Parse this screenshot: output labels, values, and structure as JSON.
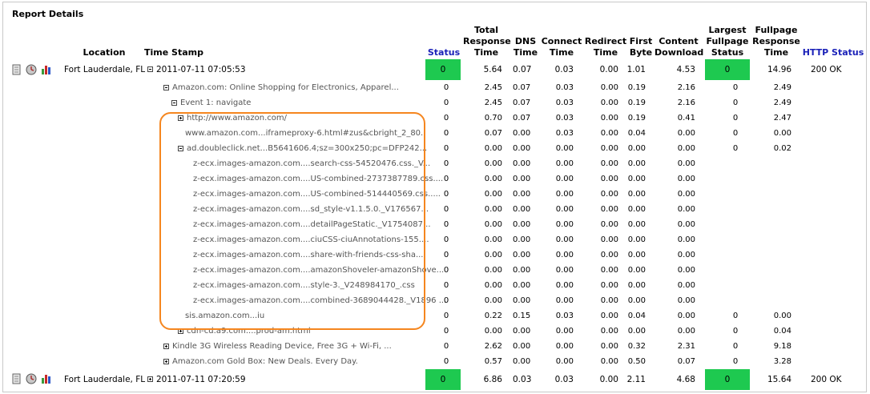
{
  "title": "Report Details",
  "headers": {
    "location": "Location",
    "timestamp": "Time Stamp",
    "status": "Status",
    "total_response_1": "Total",
    "total_response_2": "Response",
    "total_response_3": "Time",
    "dns_1": "DNS",
    "dns_2": "Time",
    "connect_1": "Connect",
    "connect_2": "Time",
    "redirect_1": "Redirect",
    "redirect_2": "Time",
    "first_byte_1": "First",
    "first_byte_2": "Byte",
    "content_1": "Content",
    "content_2": "Download",
    "largest_1": "Largest",
    "largest_2": "Fullpage",
    "largest_3": "Status",
    "fullpage_1": "Fullpage",
    "fullpage_2": "Response",
    "fullpage_3": "Time",
    "http_status": "HTTP Status"
  },
  "icons": [
    "document-icon",
    "clock-icon",
    "bar-chart-icon"
  ],
  "main_rows": [
    {
      "location": "Fort Lauderdale, FL",
      "timestamp": "2011-07-11 07:05:53",
      "status": "0",
      "total": "5.64",
      "dns": "0.07",
      "connect": "0.03",
      "redirect": "0.00",
      "first_byte": "1.01",
      "content": "4.53",
      "largest": "0",
      "fullpage": "14.96",
      "http": "200 OK",
      "toggle": "minus",
      "status_color": "#1ec950"
    },
    {
      "location": "Fort Lauderdale, FL",
      "timestamp": "2011-07-11 07:20:59",
      "status": "0",
      "total": "6.86",
      "dns": "0.03",
      "connect": "0.03",
      "redirect": "0.00",
      "first_byte": "2.11",
      "content": "4.68",
      "largest": "0",
      "fullpage": "15.64",
      "http": "200 OK",
      "toggle": "plus",
      "status_color": "#1ec950"
    }
  ],
  "sub_rows": [
    {
      "label": "Amazon.com: Online Shopping for Electronics, Apparel...",
      "toggle": "minus",
      "status": "0",
      "total": "2.45",
      "dns": "0.07",
      "connect": "0.03",
      "redirect": "0.00",
      "first_byte": "0.19",
      "content": "2.16",
      "largest": "0",
      "fullpage": "2.49"
    },
    {
      "label": "Event 1: navigate",
      "toggle": "minus",
      "status": "0",
      "total": "2.45",
      "dns": "0.07",
      "connect": "0.03",
      "redirect": "0.00",
      "first_byte": "0.19",
      "content": "2.16",
      "largest": "0",
      "fullpage": "2.49"
    },
    {
      "label": "http://www.amazon.com/",
      "toggle": "plus",
      "status": "0",
      "total": "0.70",
      "dns": "0.07",
      "connect": "0.03",
      "redirect": "0.00",
      "first_byte": "0.19",
      "content": "0.41",
      "largest": "0",
      "fullpage": "2.47"
    },
    {
      "label": "www.amazon.com...iframeproxy-6.html#zus&cbright_2_80.",
      "toggle": "",
      "status": "0",
      "total": "0.07",
      "dns": "0.00",
      "connect": "0.03",
      "redirect": "0.00",
      "first_byte": "0.04",
      "content": "0.00",
      "largest": "0",
      "fullpage": "0.00"
    },
    {
      "label": "ad.doubleclick.net...B5641606.4;sz=300x250;pc=DFP242...",
      "toggle": "minus",
      "status": "0",
      "total": "0.00",
      "dns": "0.00",
      "connect": "0.00",
      "redirect": "0.00",
      "first_byte": "0.00",
      "content": "0.00",
      "largest": "0",
      "fullpage": "0.02"
    },
    {
      "label": "z-ecx.images-amazon.com....search-css-54520476.css._V...",
      "toggle": "",
      "status": "0",
      "total": "0.00",
      "dns": "0.00",
      "connect": "0.00",
      "redirect": "0.00",
      "first_byte": "0.00",
      "content": "0.00",
      "largest": "",
      "fullpage": ""
    },
    {
      "label": "z-ecx.images-amazon.com....US-combined-2737387789.css....",
      "toggle": "",
      "status": "0",
      "total": "0.00",
      "dns": "0.00",
      "connect": "0.00",
      "redirect": "0.00",
      "first_byte": "0.00",
      "content": "0.00",
      "largest": "",
      "fullpage": ""
    },
    {
      "label": "z-ecx.images-amazon.com....US-combined-514440569.css.....",
      "toggle": "",
      "status": "0",
      "total": "0.00",
      "dns": "0.00",
      "connect": "0.00",
      "redirect": "0.00",
      "first_byte": "0.00",
      "content": "0.00",
      "largest": "",
      "fullpage": ""
    },
    {
      "label": "z-ecx.images-amazon.com....sd_style-v1.1.5.0._V176567...",
      "toggle": "",
      "status": "0",
      "total": "0.00",
      "dns": "0.00",
      "connect": "0.00",
      "redirect": "0.00",
      "first_byte": "0.00",
      "content": "0.00",
      "largest": "",
      "fullpage": ""
    },
    {
      "label": "z-ecx.images-amazon.com....detailPageStatic._V1754087...",
      "toggle": "",
      "status": "0",
      "total": "0.00",
      "dns": "0.00",
      "connect": "0.00",
      "redirect": "0.00",
      "first_byte": "0.00",
      "content": "0.00",
      "largest": "",
      "fullpage": ""
    },
    {
      "label": "z-ecx.images-amazon.com....ciuCSS-ciuAnnotations-155....",
      "toggle": "",
      "status": "0",
      "total": "0.00",
      "dns": "0.00",
      "connect": "0.00",
      "redirect": "0.00",
      "first_byte": "0.00",
      "content": "0.00",
      "largest": "",
      "fullpage": ""
    },
    {
      "label": "z-ecx.images-amazon.com....share-with-friends-css-sha...",
      "toggle": "",
      "status": "0",
      "total": "0.00",
      "dns": "0.00",
      "connect": "0.00",
      "redirect": "0.00",
      "first_byte": "0.00",
      "content": "0.00",
      "largest": "",
      "fullpage": ""
    },
    {
      "label": "z-ecx.images-amazon.com....amazonShoveler-amazonShove...",
      "toggle": "",
      "status": "0",
      "total": "0.00",
      "dns": "0.00",
      "connect": "0.00",
      "redirect": "0.00",
      "first_byte": "0.00",
      "content": "0.00",
      "largest": "",
      "fullpage": ""
    },
    {
      "label": "z-ecx.images-amazon.com....style-3._V248984170_.css",
      "toggle": "",
      "status": "0",
      "total": "0.00",
      "dns": "0.00",
      "connect": "0.00",
      "redirect": "0.00",
      "first_byte": "0.00",
      "content": "0.00",
      "largest": "",
      "fullpage": ""
    },
    {
      "label": "z-ecx.images-amazon.com....combined-3689044428._V1896 ...",
      "toggle": "",
      "status": "0",
      "total": "0.00",
      "dns": "0.00",
      "connect": "0.00",
      "redirect": "0.00",
      "first_byte": "0.00",
      "content": "0.00",
      "largest": "",
      "fullpage": ""
    },
    {
      "label": "sis.amazon.com...iu",
      "toggle": "",
      "status": "0",
      "total": "0.22",
      "dns": "0.15",
      "connect": "0.03",
      "redirect": "0.00",
      "first_byte": "0.04",
      "content": "0.00",
      "largest": "0",
      "fullpage": "0.00"
    },
    {
      "label": "cdn-cd.a9.com....prod-am.html",
      "toggle": "plus",
      "status": "0",
      "total": "0.00",
      "dns": "0.00",
      "connect": "0.00",
      "redirect": "0.00",
      "first_byte": "0.00",
      "content": "0.00",
      "largest": "0",
      "fullpage": "0.04"
    },
    {
      "label": "Kindle 3G Wireless Reading Device, Free 3G + Wi-Fi, ...",
      "toggle": "plus",
      "status": "0",
      "total": "2.62",
      "dns": "0.00",
      "connect": "0.00",
      "redirect": "0.00",
      "first_byte": "0.32",
      "content": "2.31",
      "largest": "0",
      "fullpage": "9.18"
    },
    {
      "label": "Amazon.com Gold Box: New Deals. Every Day.",
      "toggle": "plus",
      "status": "0",
      "total": "0.57",
      "dns": "0.00",
      "connect": "0.00",
      "redirect": "0.00",
      "first_byte": "0.50",
      "content": "0.07",
      "largest": "0",
      "fullpage": "3.28"
    }
  ]
}
